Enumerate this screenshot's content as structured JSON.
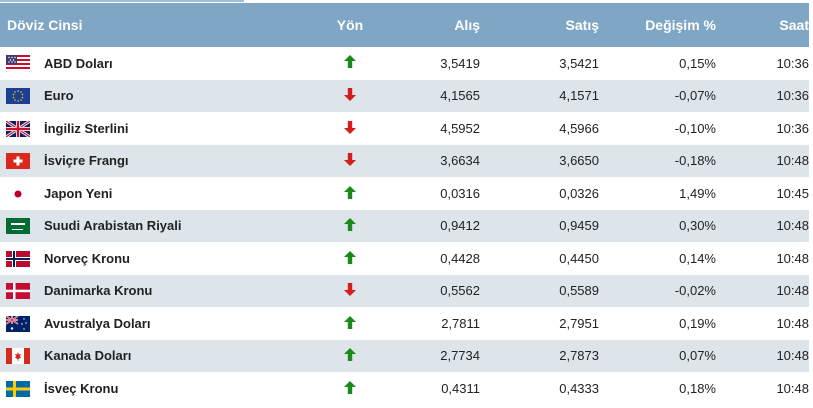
{
  "headers": {
    "name": "Döviz Cinsi",
    "direction": "Yön",
    "buy": "Alış",
    "sell": "Satış",
    "change": "Değişim %",
    "time": "Saat"
  },
  "colors": {
    "header_bg": "#7fa6c4",
    "row_alt": "#dde4ea",
    "up": "#1a8a1a",
    "down": "#d41e1e"
  },
  "rows": [
    {
      "flag": "us-flag",
      "name": "ABD Doları",
      "dir": "up",
      "buy": "3,5419",
      "sell": "3,5421",
      "change": "0,15%",
      "time": "10:36"
    },
    {
      "flag": "eu-flag",
      "name": "Euro",
      "dir": "down",
      "buy": "4,1565",
      "sell": "4,1571",
      "change": "-0,07%",
      "time": "10:36"
    },
    {
      "flag": "gb-flag",
      "name": "İngiliz Sterlini",
      "dir": "down",
      "buy": "4,5952",
      "sell": "4,5966",
      "change": "-0,10%",
      "time": "10:36"
    },
    {
      "flag": "ch-flag",
      "name": "İsviçre Frangı",
      "dir": "down",
      "buy": "3,6634",
      "sell": "3,6650",
      "change": "-0,18%",
      "time": "10:48"
    },
    {
      "flag": "jp-flag",
      "name": "Japon Yeni",
      "dir": "up",
      "buy": "0,0316",
      "sell": "0,0326",
      "change": "1,49%",
      "time": "10:45"
    },
    {
      "flag": "sa-flag",
      "name": "Suudi Arabistan Riyali",
      "dir": "up",
      "buy": "0,9412",
      "sell": "0,9459",
      "change": "0,30%",
      "time": "10:48"
    },
    {
      "flag": "no-flag",
      "name": "Norveç Kronu",
      "dir": "up",
      "buy": "0,4428",
      "sell": "0,4450",
      "change": "0,14%",
      "time": "10:48"
    },
    {
      "flag": "dk-flag",
      "name": "Danimarka Kronu",
      "dir": "down",
      "buy": "0,5562",
      "sell": "0,5589",
      "change": "-0,02%",
      "time": "10:48"
    },
    {
      "flag": "au-flag",
      "name": "Avustralya Doları",
      "dir": "up",
      "buy": "2,7811",
      "sell": "2,7951",
      "change": "0,19%",
      "time": "10:48"
    },
    {
      "flag": "ca-flag",
      "name": "Kanada Doları",
      "dir": "up",
      "buy": "2,7734",
      "sell": "2,7873",
      "change": "0,07%",
      "time": "10:48"
    },
    {
      "flag": "se-flag",
      "name": "İsveç Kronu",
      "dir": "up",
      "buy": "0,4311",
      "sell": "0,4333",
      "change": "0,18%",
      "time": "10:48"
    }
  ]
}
